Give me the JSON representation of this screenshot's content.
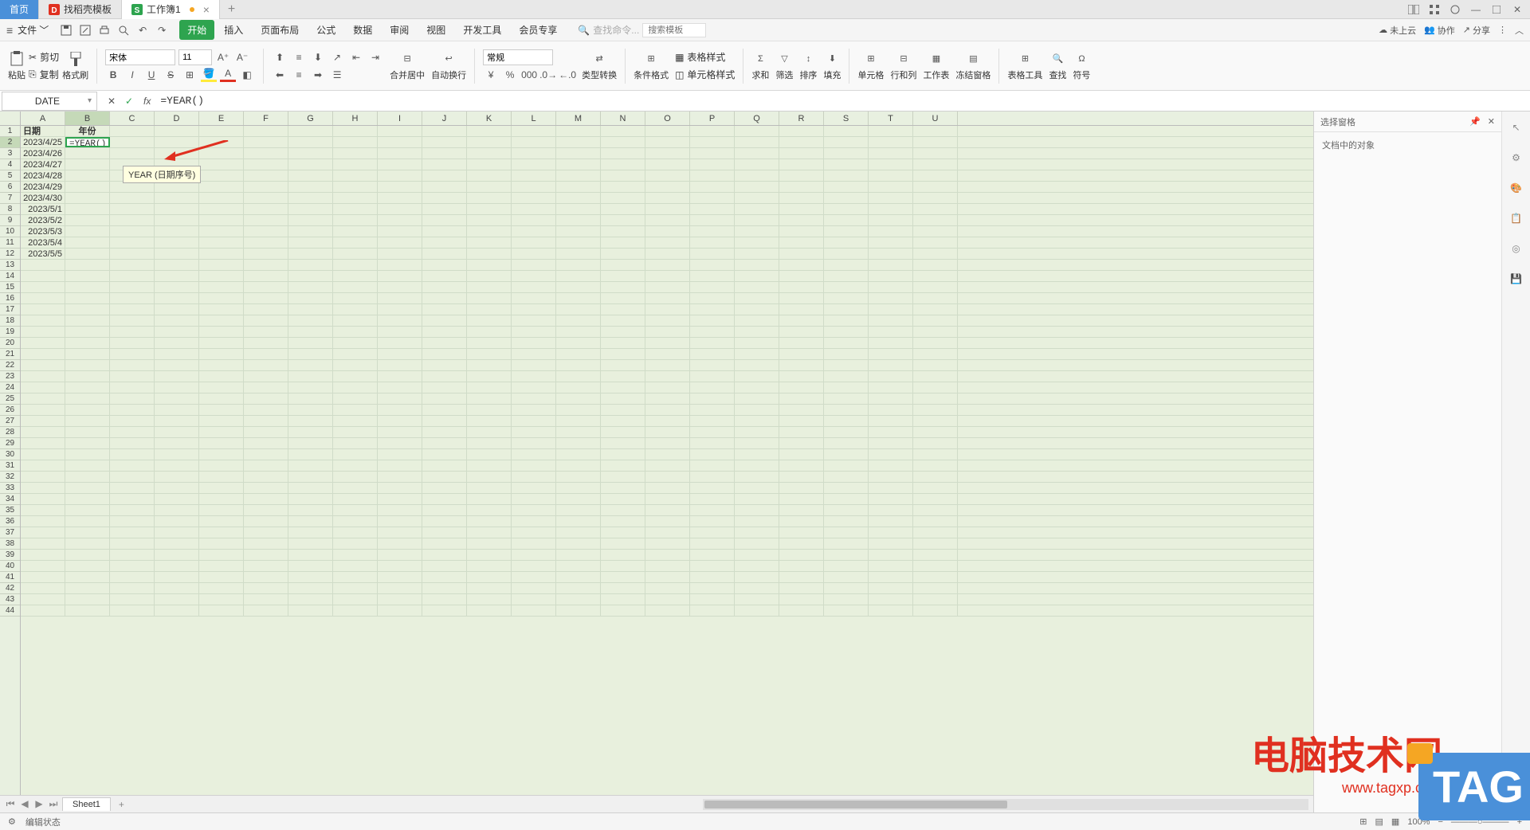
{
  "tabs": {
    "home": "首页",
    "template": "找稻壳模板",
    "workbook": "工作簿1"
  },
  "menu": {
    "file": "文件",
    "tabs": [
      "开始",
      "插入",
      "页面布局",
      "公式",
      "数据",
      "审阅",
      "视图",
      "开发工具",
      "会员专享"
    ],
    "search_cmd": "查找命令...",
    "search_tpl": "搜索模板"
  },
  "menu_right": {
    "cloud": "未上云",
    "collab": "协作",
    "share": "分享"
  },
  "ribbon": {
    "paste": "粘贴",
    "cut": "剪切",
    "copy": "复制",
    "painter": "格式刷",
    "font": "宋体",
    "size": "11",
    "number_fmt": "常规",
    "merge": "合并居中",
    "wrap": "自动换行",
    "convert": "类型转换",
    "cond": "条件格式",
    "table_style": "表格样式",
    "cell_style": "单元格样式",
    "sum": "求和",
    "filter": "筛选",
    "sort": "排序",
    "fill": "填充",
    "cell": "单元格",
    "rowcol": "行和列",
    "worksheet": "工作表",
    "freeze": "冻结窗格",
    "tools": "表格工具",
    "find": "查找",
    "symbol": "符号"
  },
  "formula_bar": {
    "name": "DATE",
    "formula": "=YEAR()"
  },
  "columns": [
    "A",
    "B",
    "C",
    "D",
    "E",
    "F",
    "G",
    "H",
    "I",
    "J",
    "K",
    "L",
    "M",
    "N",
    "O",
    "P",
    "Q",
    "R",
    "S",
    "T",
    "U"
  ],
  "sheet": {
    "header_a": "日期",
    "header_b": "年份",
    "dates": [
      "2023/4/25",
      "2023/4/26",
      "2023/4/27",
      "2023/4/28",
      "2023/4/29",
      "2023/4/30",
      "2023/5/1",
      "2023/5/2",
      "2023/5/3",
      "2023/5/4",
      "2023/5/5"
    ],
    "editing_cell": "=YEAR()",
    "hint": "YEAR (日期序号)"
  },
  "side_panel": {
    "title": "选择窗格",
    "sub": "文档中的对象"
  },
  "sheet_tabs": {
    "sheet1": "Sheet1"
  },
  "status": {
    "mode": "编辑状态",
    "zoom": "100%"
  },
  "watermark": {
    "site": "电脑技术网",
    "url": "www.tagxp.com",
    "tag": "TAG"
  }
}
